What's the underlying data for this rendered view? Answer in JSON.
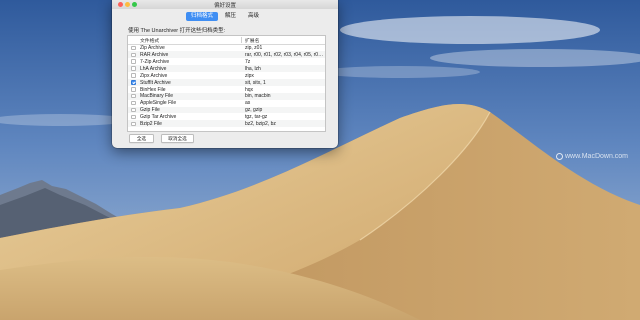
{
  "window": {
    "title": "偏好设置"
  },
  "tabs": [
    {
      "label": "归档格式",
      "active": true
    },
    {
      "label": "解压",
      "active": false
    },
    {
      "label": "高级",
      "active": false
    }
  ],
  "prompt": "使用 The Unarchiver 打开这些归档类型:",
  "columns": {
    "name": "文件格式",
    "ext": "扩展名"
  },
  "formats": [
    {
      "name": "Zip Archive",
      "ext": "zip, z01",
      "checked": false
    },
    {
      "name": "RAR Archive",
      "ext": "rar, r00, r01, r02, r03, r04, r05, r06, r...",
      "checked": false
    },
    {
      "name": "7-Zip Archive",
      "ext": "7z",
      "checked": false
    },
    {
      "name": "LhA Archive",
      "ext": "lha, lzh",
      "checked": false
    },
    {
      "name": "Zipx Archive",
      "ext": "zipx",
      "checked": false
    },
    {
      "name": "StuffIt Archive",
      "ext": "sit, sitx, 1",
      "checked": true
    },
    {
      "name": "BinHex File",
      "ext": "hqx",
      "checked": false
    },
    {
      "name": "MacBinary File",
      "ext": "bin, macbin",
      "checked": false
    },
    {
      "name": "AppleSingle File",
      "ext": "as",
      "checked": false
    },
    {
      "name": "Gzip File",
      "ext": "gz, gzip",
      "checked": false
    },
    {
      "name": "Gzip Tar Archive",
      "ext": "tgz, tar-gz",
      "checked": false
    },
    {
      "name": "Bzip2 File",
      "ext": "bz2, bzip2, bz",
      "checked": false
    }
  ],
  "buttons": {
    "select_all": "全选",
    "deselect_all": "取消全选"
  },
  "watermark": "www.MacDown.com",
  "colors": {
    "accent": "#3f8ef3",
    "sky": "#4a72ad",
    "sand": "#d8b680"
  }
}
